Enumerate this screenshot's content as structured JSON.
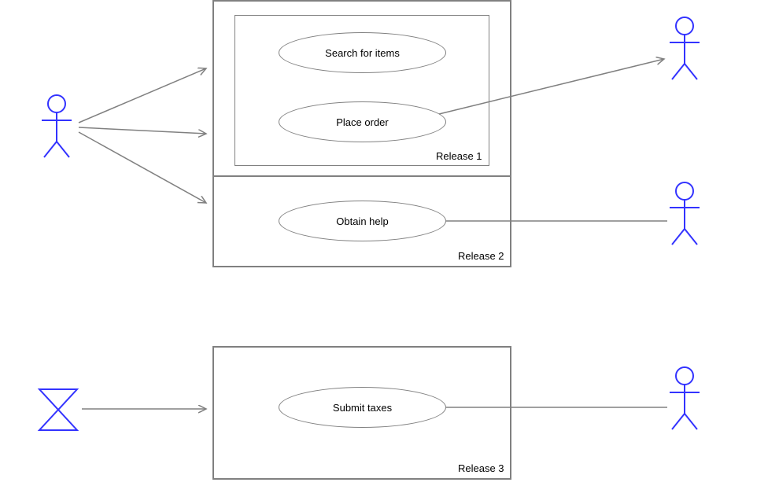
{
  "usecases": {
    "search": "Search for items",
    "place": "Place order",
    "help": "Obtain help",
    "taxes": "Submit taxes"
  },
  "labels": {
    "release1": "Release 1",
    "release2": "Release 2",
    "release3": "Release 3"
  }
}
